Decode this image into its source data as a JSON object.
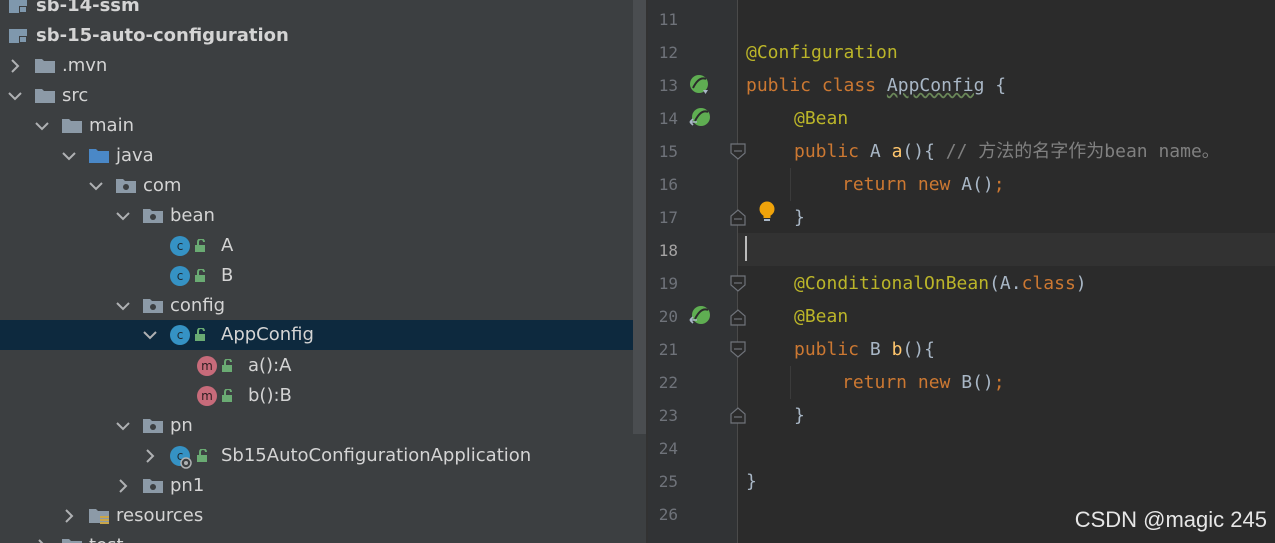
{
  "project_tree": {
    "rows": [
      {
        "label": "sb-14-ssm",
        "icon": "module-icon"
      },
      {
        "label": "sb-15-auto-configuration",
        "icon": "module-icon"
      },
      {
        "label": ".mvn",
        "icon": "folder-icon"
      },
      {
        "label": "src",
        "icon": "folder-icon"
      },
      {
        "label": "main",
        "icon": "folder-icon"
      },
      {
        "label": "java",
        "icon": "source-folder-icon"
      },
      {
        "label": "com",
        "icon": "package-icon"
      },
      {
        "label": "bean",
        "icon": "package-icon"
      },
      {
        "label": "A",
        "icon": "class-icon"
      },
      {
        "label": "B",
        "icon": "class-icon"
      },
      {
        "label": "config",
        "icon": "package-icon"
      },
      {
        "label": "AppConfig",
        "icon": "class-icon"
      },
      {
        "label": "a():A",
        "icon": "method-icon"
      },
      {
        "label": "b():B",
        "icon": "method-icon"
      },
      {
        "label": "pn",
        "icon": "package-icon"
      },
      {
        "label": "Sb15AutoConfigurationApplication",
        "icon": "spring-boot-class-icon"
      },
      {
        "label": "pn1",
        "icon": "package-icon"
      },
      {
        "label": "resources",
        "icon": "resources-folder-icon"
      },
      {
        "label": "test",
        "icon": "folder-icon"
      }
    ],
    "class_badge": "c",
    "method_badge": "m"
  },
  "editor": {
    "line_numbers": [
      "11",
      "12",
      "13",
      "14",
      "15",
      "16",
      "17",
      "18",
      "19",
      "20",
      "21",
      "22",
      "23",
      "24",
      "25",
      "26"
    ],
    "current_line": "18",
    "code": {
      "l12_annotation": "@Configuration",
      "l13_public": "public",
      "l13_class": "class",
      "l13_name": "AppConfig",
      "l13_brace": "{",
      "l14_annotation": "@Bean",
      "l15_public": "public",
      "l15_type": "A",
      "l15_method": "a",
      "l15_rest": "(){",
      "l15_comment": "// 方法的名字作为bean name。",
      "l16_return": "return",
      "l16_new": "new",
      "l16_rest": "A()",
      "l16_semi": ";",
      "l17_brace": "}",
      "l19_annotation": "@ConditionalOnBean",
      "l19_arg_open": "(A.",
      "l19_class": "class",
      "l19_arg_close": ")",
      "l20_annotation": "@Bean",
      "l21_public": "public",
      "l21_type": "B",
      "l21_method": "b",
      "l21_rest": "(){",
      "l22_return": "return",
      "l22_new": "new",
      "l22_rest": "B()",
      "l22_semi": ";",
      "l23_brace": "}",
      "l25_brace": "}"
    }
  },
  "watermark": "CSDN @magic 245",
  "colors": {
    "background": "#2b2b2b",
    "tree_background": "#3c3f41",
    "selection": "#0d293e",
    "keyword": "#cc7832",
    "annotation": "#bbb529",
    "method": "#ffc66d",
    "comment": "#808080",
    "text": "#a9b7c6"
  }
}
